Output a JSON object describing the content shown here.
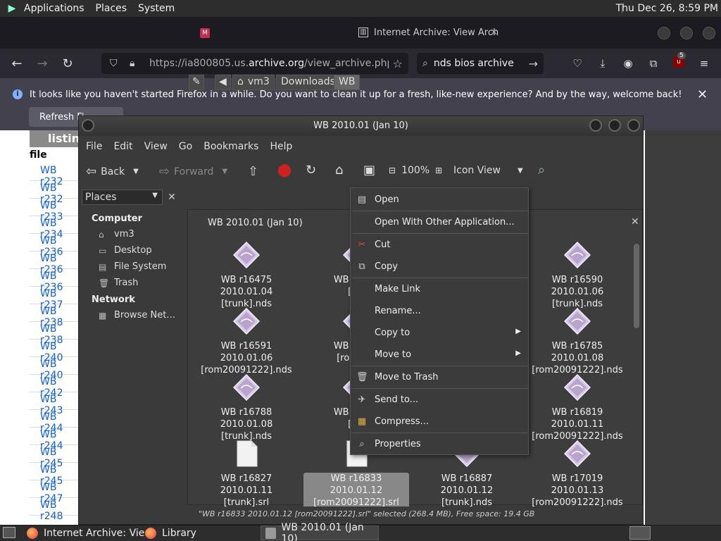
{
  "top_panel": {
    "menus": [
      "Applications",
      "Places",
      "System"
    ],
    "clock": "Thu Dec 26,  8:59 PM"
  },
  "firefox": {
    "active_tab": "Internet Archive: View Arch",
    "url_prefix": "https://ia800805.us.",
    "url_domain": "archive.org",
    "url_suffix": "/view_archive.php?arch",
    "search_text": "nds bios archive",
    "badge_count": "5",
    "notification": "It looks like you haven't started Firefox in a while. Do you want to clean it up for a fresh, like-new experience? And by the way, welcome back!",
    "refresh_label": "Refresh Fi..."
  },
  "background_page": {
    "header": "listing",
    "column": "file",
    "rows": [
      "WB r232",
      "WB r232",
      "WB r233",
      "WB r234",
      "WB r236",
      "WB r236",
      "WB r236",
      "WB r237",
      "WB r238",
      "WB r238",
      "WB r240",
      "WB r240",
      "WB r242",
      "WB r243",
      "WB r244",
      "WB r244",
      "WB r245",
      "WB r245",
      "WB r247",
      "WB r248"
    ]
  },
  "file_manager": {
    "title": "WB 2010.01 (Jan 10)",
    "menu": [
      "File",
      "Edit",
      "View",
      "Go",
      "Bookmarks",
      "Help"
    ],
    "toolbar": {
      "back": "Back",
      "forward": "Forward",
      "zoom": "100%",
      "view_mode": "Icon View"
    },
    "places_header": "Places",
    "places": {
      "computer_label": "Computer",
      "computer_items": [
        "vm3",
        "Desktop",
        "File System",
        "Trash"
      ],
      "network_label": "Network",
      "network_items": [
        "Browse Net…"
      ]
    },
    "path": [
      "vm3",
      "Downloads",
      "WB"
    ],
    "folder_header": "WB 2010.01 (Jan 10)",
    "files": [
      {
        "line1": "WB r16475 2010.01.04",
        "line2": "[trunk].nds",
        "type": "nds"
      },
      {
        "line1": "WB r1652",
        "line2": "[tru",
        "type": "nds"
      },
      {
        "line1": "",
        "line2": "",
        "type": "nds"
      },
      {
        "line1": "WB r16590 2010.01.06",
        "line2": "[trunk].nds",
        "type": "nds"
      },
      {
        "line1": "WB r16591 2010.01.06",
        "line2": "[rom20091222].nds",
        "type": "nds"
      },
      {
        "line1": "WB r1670",
        "line2": "[rom200",
        "type": "nds"
      },
      {
        "line1": "",
        "line2": "",
        "type": "nds"
      },
      {
        "line1": "WB r16785 2010.01.08",
        "line2": "[rom20091222].nds",
        "type": "nds"
      },
      {
        "line1": "WB r16788 2010.01.08",
        "line2": "[trunk].nds",
        "type": "nds"
      },
      {
        "line1": "WB r1680",
        "line2": "[tru",
        "type": "nds"
      },
      {
        "line1": "",
        "line2": "",
        "type": "nds"
      },
      {
        "line1": "WB r16819 2010.01.11",
        "line2": "[rom20091222].nds",
        "type": "nds"
      },
      {
        "line1": "WB r16827 2010.01.11",
        "line2": "[trunk].srl",
        "type": "srl"
      },
      {
        "line1": "WB r16833 2010.01.12",
        "line2": "[rom20091222].srl",
        "type": "srl"
      },
      {
        "line1": "WB r16887 2010.01.12",
        "line2": "[trunk].nds",
        "type": "nds"
      },
      {
        "line1": "WB r17019 2010.01.13",
        "line2": "[rom20091222].nds",
        "type": "nds"
      }
    ],
    "status": "\"WB r16833 2010.01.12 [rom20091222].srl\" selected (268.4 MB), Free space: 19.4 GB"
  },
  "context_menu": {
    "items": [
      "Open",
      "Open With Other Application...",
      "Cut",
      "Copy",
      "Make Link",
      "Rename...",
      "Copy to",
      "Move to",
      "Move to Trash",
      "Send to...",
      "Compress...",
      "Properties"
    ]
  },
  "taskbar": {
    "items": [
      "Internet Archive: Vie...",
      "Library",
      "WB 2010.01 (Jan 10)"
    ]
  }
}
